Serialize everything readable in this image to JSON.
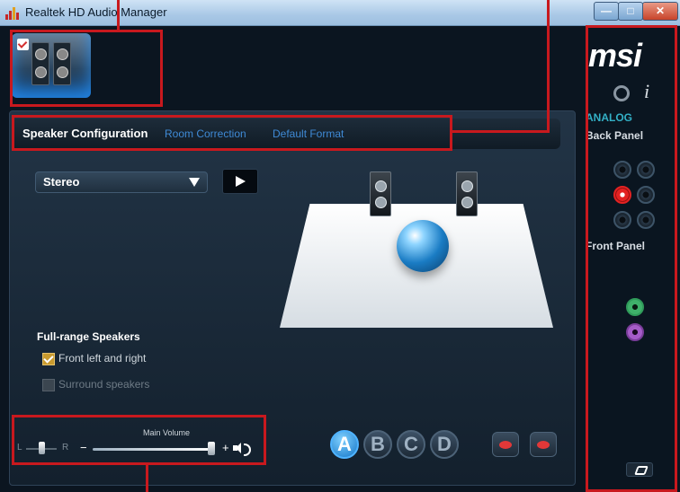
{
  "window": {
    "title": "Realtek HD Audio Manager",
    "buttons": {
      "minimize": "—",
      "maximize": "□",
      "close": "✕"
    }
  },
  "tabs": [
    {
      "label": "Speaker Configuration",
      "active": true
    },
    {
      "label": "Room Correction",
      "active": false
    },
    {
      "label": "Default Format",
      "active": false
    }
  ],
  "speaker_config": {
    "mode_selected": "Stereo",
    "full_range_title": "Full-range Speakers",
    "options": [
      {
        "label": "Front left and right",
        "checked": true,
        "enabled": true
      },
      {
        "label": "Surround speakers",
        "checked": false,
        "enabled": false
      }
    ]
  },
  "volume": {
    "title": "Main Volume",
    "balance_left": "L",
    "balance_right": "R",
    "minus": "−",
    "plus": "+",
    "level_fraction": 0.97,
    "balance_fraction": 0.5
  },
  "profiles": [
    "A",
    "B",
    "C",
    "D"
  ],
  "sidebar": {
    "logo": "msi",
    "info": "i",
    "analog_label": "ANALOG",
    "back_panel_label": "Back Panel",
    "front_panel_label": "Front Panel"
  },
  "colors": {
    "accent_blue": "#3f8ad6",
    "annotation_red": "#c8191e",
    "analog_cyan": "#33b0c6"
  }
}
